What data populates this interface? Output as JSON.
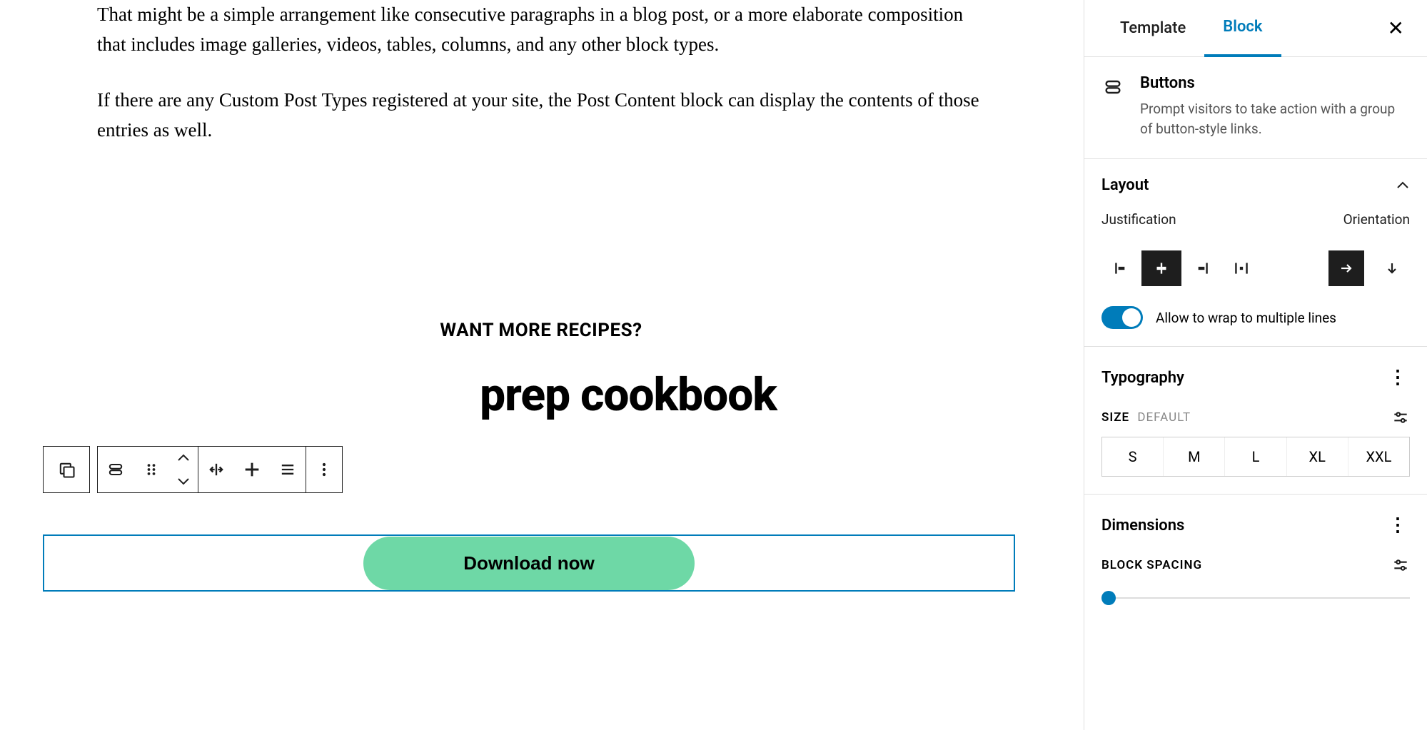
{
  "content": {
    "paragraph1": "That might be a simple arrangement like consecutive paragraphs in a blog post, or a more elaborate composition that includes image galleries, videos, tables, columns, and any other block types.",
    "paragraph2": "If there are any Custom Post Types registered at your site, the Post Content block can display the contents of those entries as well.",
    "eyebrow": "WANT MORE RECIPES?",
    "headline_partial": "prep cookbook",
    "button_label": "Download now"
  },
  "toolbar": {
    "parent_select": "parent-block",
    "items": [
      "buttons-block-icon",
      "drag-handle",
      "move",
      "justify",
      "align",
      "content-justify",
      "more-options"
    ]
  },
  "sidebar": {
    "tabs": {
      "template": "Template",
      "block": "Block"
    },
    "block": {
      "title": "Buttons",
      "description": "Prompt visitors to take action with a group of button-style links."
    },
    "layout": {
      "title": "Layout",
      "justification_label": "Justification",
      "orientation_label": "Orientation",
      "wrap_label": "Allow to wrap to multiple lines",
      "wrap_on": true
    },
    "typography": {
      "title": "Typography",
      "size_label": "SIZE",
      "size_default": "DEFAULT",
      "sizes": [
        "S",
        "M",
        "L",
        "XL",
        "XXL"
      ]
    },
    "dimensions": {
      "title": "Dimensions",
      "spacing_label": "BLOCK SPACING"
    }
  }
}
